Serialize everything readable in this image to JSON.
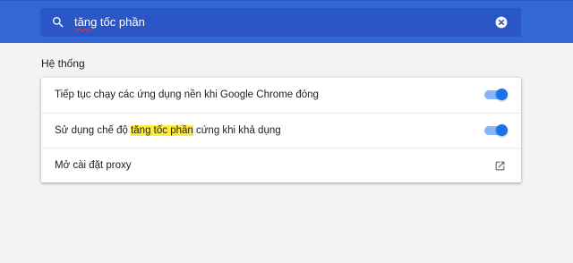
{
  "search": {
    "value_before": "",
    "value_spell": "tăng",
    "value_after": " tốc phần",
    "icon": "search-icon",
    "clear_icon": "close-icon"
  },
  "section": {
    "title": "Hệ thống"
  },
  "settings": [
    {
      "label": "Tiếp tục chạy các ứng dụng nền khi Google Chrome đóng",
      "type": "toggle",
      "enabled": true
    },
    {
      "label_before": "Sử dụng chế độ ",
      "label_highlight": "tăng tốc phần",
      "label_after": " cứng khi khả dụng",
      "type": "toggle",
      "enabled": true
    },
    {
      "label": "Mở cài đặt proxy",
      "type": "link",
      "icon": "open-external-icon"
    }
  ],
  "colors": {
    "header": "#3367d6",
    "search_box": "#2a56c6",
    "toggle_on": "#1a73e8",
    "highlight": "#ffeb3b",
    "background": "#f1f3f4"
  }
}
